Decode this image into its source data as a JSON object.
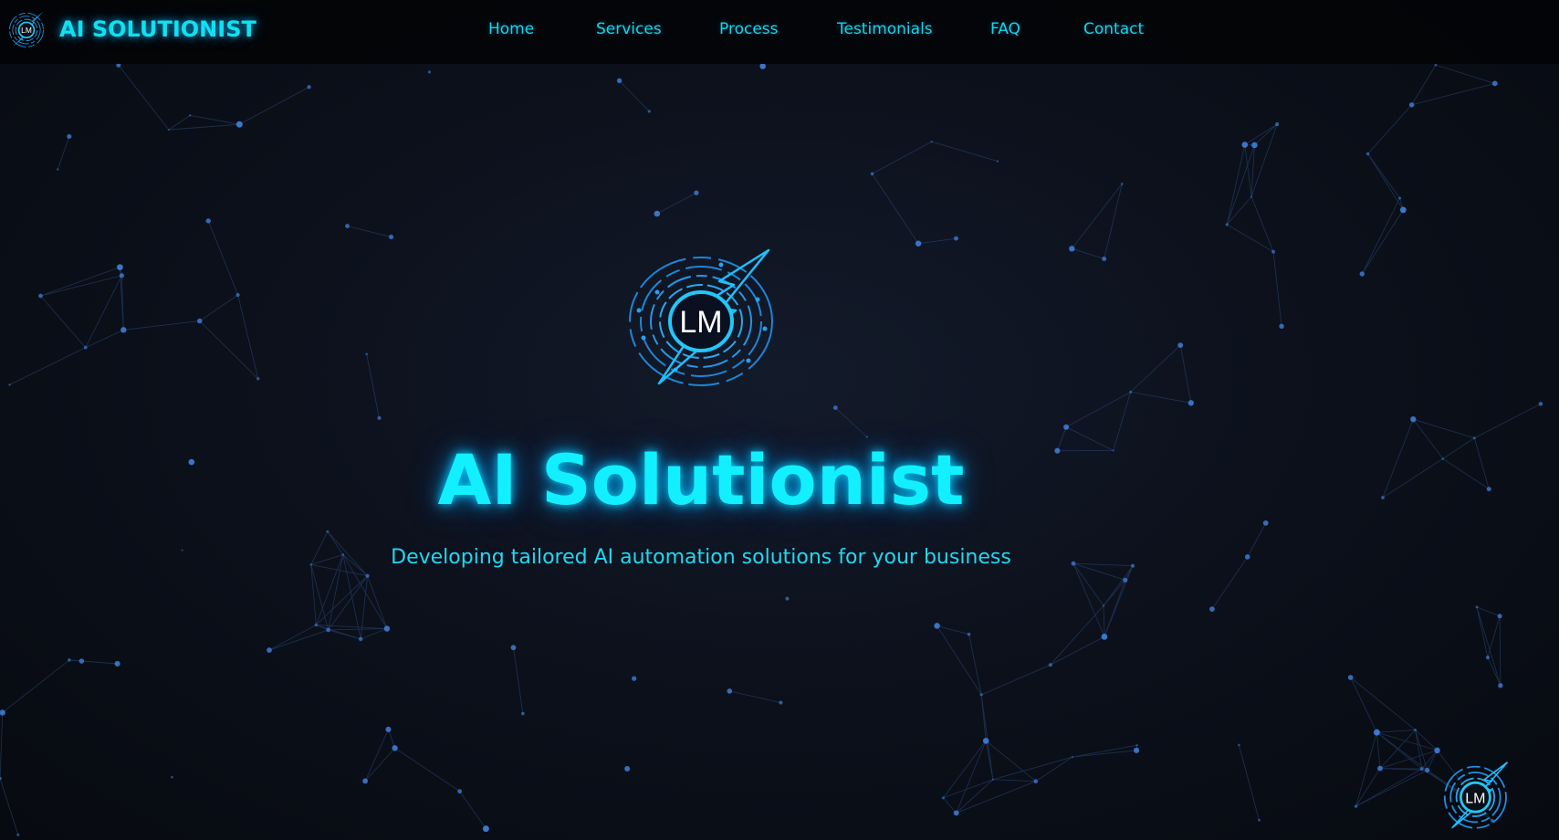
{
  "header": {
    "brand_name": "AI SOLUTIONIST",
    "logo_initials": "LM",
    "nav": [
      {
        "label": "Home"
      },
      {
        "label": "Services"
      },
      {
        "label": "Process"
      },
      {
        "label": "Testimonials"
      },
      {
        "label": "FAQ"
      },
      {
        "label": "Contact"
      }
    ]
  },
  "hero": {
    "logo_initials": "LM",
    "title": "AI Solutionist",
    "subtitle": "Developing tailored AI automation solutions for your business"
  },
  "floating_logo": {
    "logo_initials": "LM"
  },
  "theme": {
    "accent": "#12f0ff",
    "nav_text": "#14d6ee",
    "background": "#0c111c",
    "network_node": "#3f7fd8",
    "network_line": "#2a4a78"
  },
  "icons": [
    "lm-lightning-logo"
  ]
}
